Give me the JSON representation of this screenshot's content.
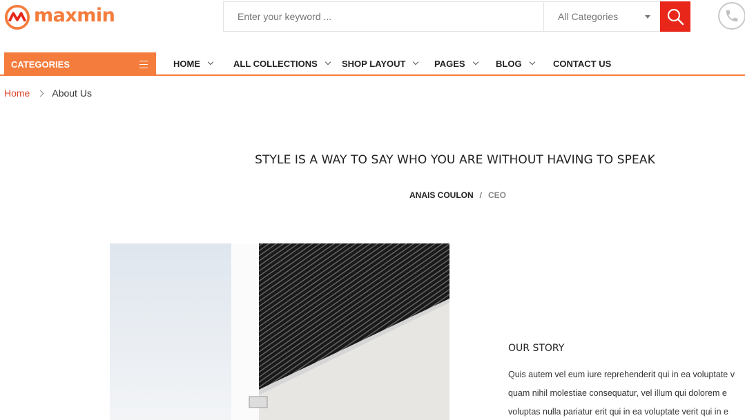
{
  "brand": {
    "name": "maxmin",
    "accent": "#f47c3c",
    "red": "#e8261a"
  },
  "search": {
    "placeholder": "Enter your keyword ...",
    "category_selected": "All Categories",
    "button_icon": "search-icon"
  },
  "header": {
    "phone_icon": "phone-icon"
  },
  "nav": {
    "categories_label": "CATEGORIES",
    "items": [
      {
        "label": "HOME",
        "has_dropdown": true
      },
      {
        "label": "ALL COLLECTIONS",
        "has_dropdown": true
      },
      {
        "label": "SHOP LAYOUT",
        "has_dropdown": true
      },
      {
        "label": "PAGES",
        "has_dropdown": true
      },
      {
        "label": "BLOG",
        "has_dropdown": true
      },
      {
        "label": "CONTACT US",
        "has_dropdown": false
      }
    ]
  },
  "breadcrumb": {
    "home": "Home",
    "current": "About Us"
  },
  "quote": {
    "text": "STYLE IS A WAY TO SAY WHO YOU ARE WITHOUT HAVING TO SPEAK",
    "author": "ANAIS COULON",
    "separator": "/",
    "role": "CEO"
  },
  "story": {
    "title": "OUR STORY",
    "lines": [
      "Quis autem vel eum iure reprehenderit qui in ea voluptate v",
      "quam nihil molestiae consequatur, vel illum qui dolorem e",
      "voluptas nulla pariatur erit qui in ea voluptate verit qui in e"
    ]
  }
}
